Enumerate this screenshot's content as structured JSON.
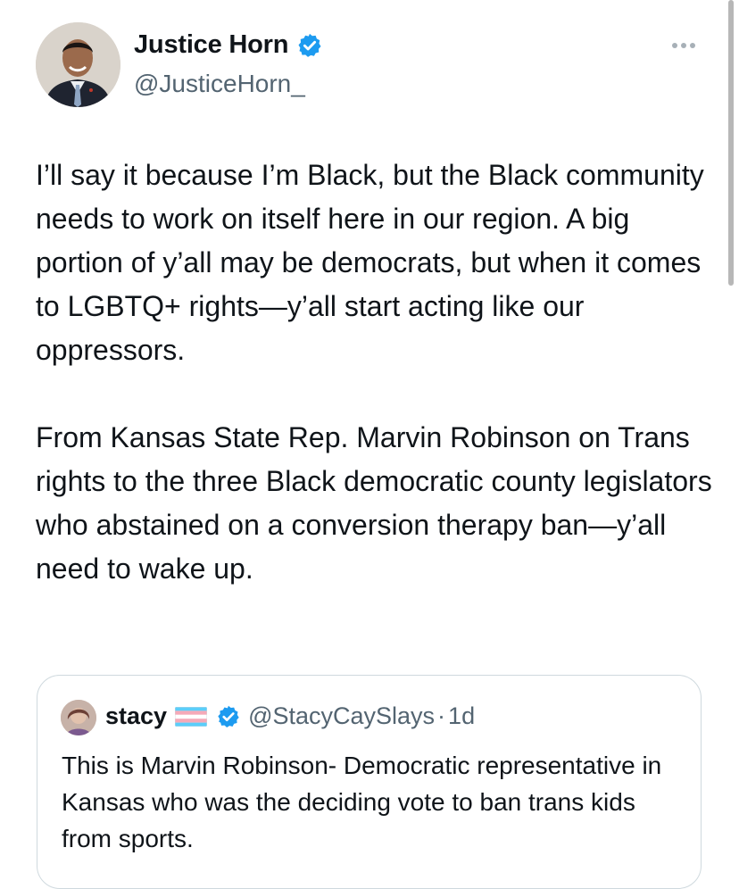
{
  "author": {
    "name": "Justice Horn",
    "handle": "@JusticeHorn_",
    "verified_icon": "verified-badge-icon"
  },
  "menu": {
    "icon": "more-options-icon"
  },
  "tweet": {
    "paragraphs": [
      "I’ll say it because I’m Black, but the Black community needs to work on itself here in our region. A big portion of y’all may be democrats, but when it comes to LGBTQ+ rights—y’all start acting like our oppressors.",
      "From Kansas State Rep. Marvin Robinson on Trans rights to the three Black democratic county legislators who abstained on a conversion therapy ban—y’all need to wake up."
    ]
  },
  "quoted": {
    "name": "stacy",
    "flag_icon": "transgender-flag-icon",
    "handle": "@StacyCaySlays",
    "separator": "·",
    "time": "1d",
    "text": "This is Marvin Robinson- Democratic representative in Kansas who was the deciding vote to ban trans kids from sports."
  },
  "colors": {
    "text": "#0f1419",
    "secondary": "#536471",
    "verified": "#1d9bf0",
    "border": "#cfd9de"
  }
}
